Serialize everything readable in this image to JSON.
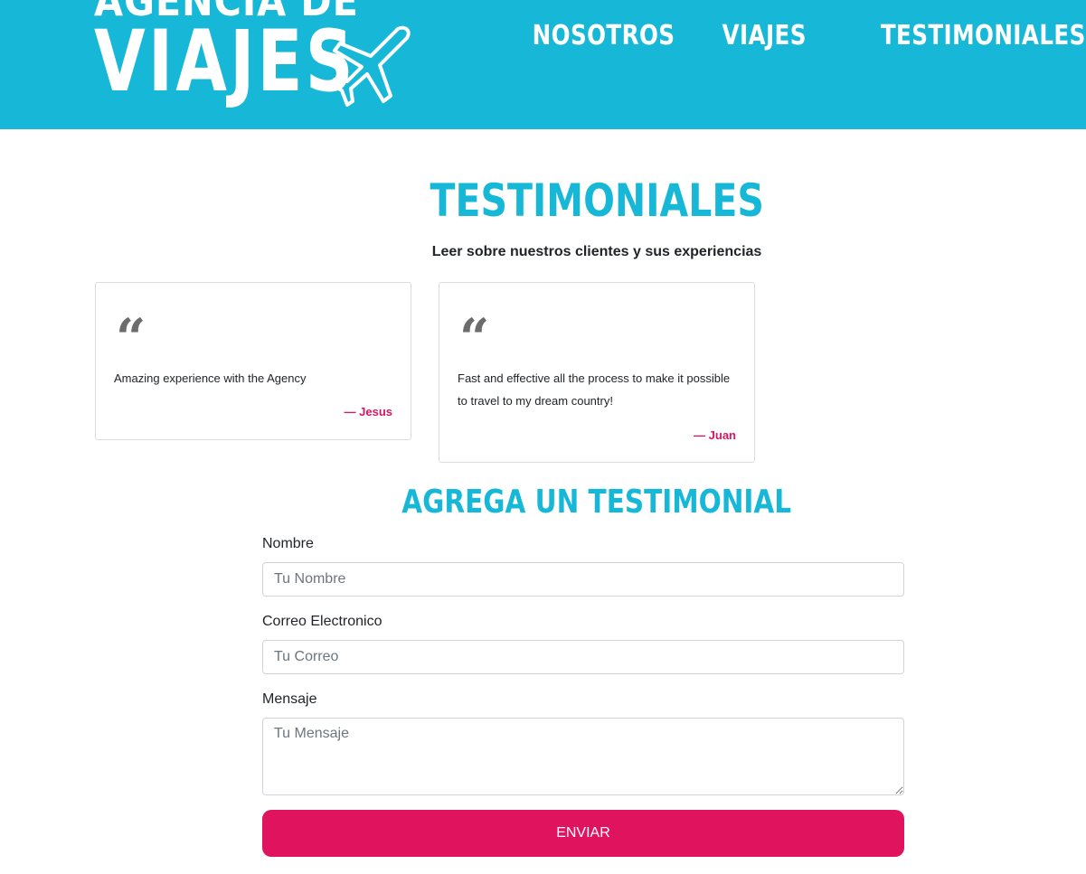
{
  "header": {
    "logo_top": "AGENCIA DE",
    "logo_bottom": "VIAJES",
    "nav": [
      {
        "label": "NOSOTROS"
      },
      {
        "label": "VIAJES"
      },
      {
        "label": "TESTIMONIALES"
      }
    ]
  },
  "testimonials": {
    "title": "TESTIMONIALES",
    "subtitle": "Leer sobre nuestros clientes y sus experiencias",
    "quote_mark": "“",
    "items": [
      {
        "text": "Amazing experience with the Agency",
        "author": "— Jesus"
      },
      {
        "text": "Fast and effective all the process to make it possible to travel to my dream country!",
        "author": "— Juan"
      }
    ]
  },
  "form": {
    "title": "AGREGA UN TESTIMONIAL",
    "name_label": "Nombre",
    "name_placeholder": "Tu Nombre",
    "email_label": "Correo Electronico",
    "email_placeholder": "Tu Correo",
    "message_label": "Mensaje",
    "message_placeholder": "Tu Mensaje",
    "submit_label": "ENVIAR"
  },
  "colors": {
    "brand": "#17b8d7",
    "accent": "#e0135f"
  }
}
